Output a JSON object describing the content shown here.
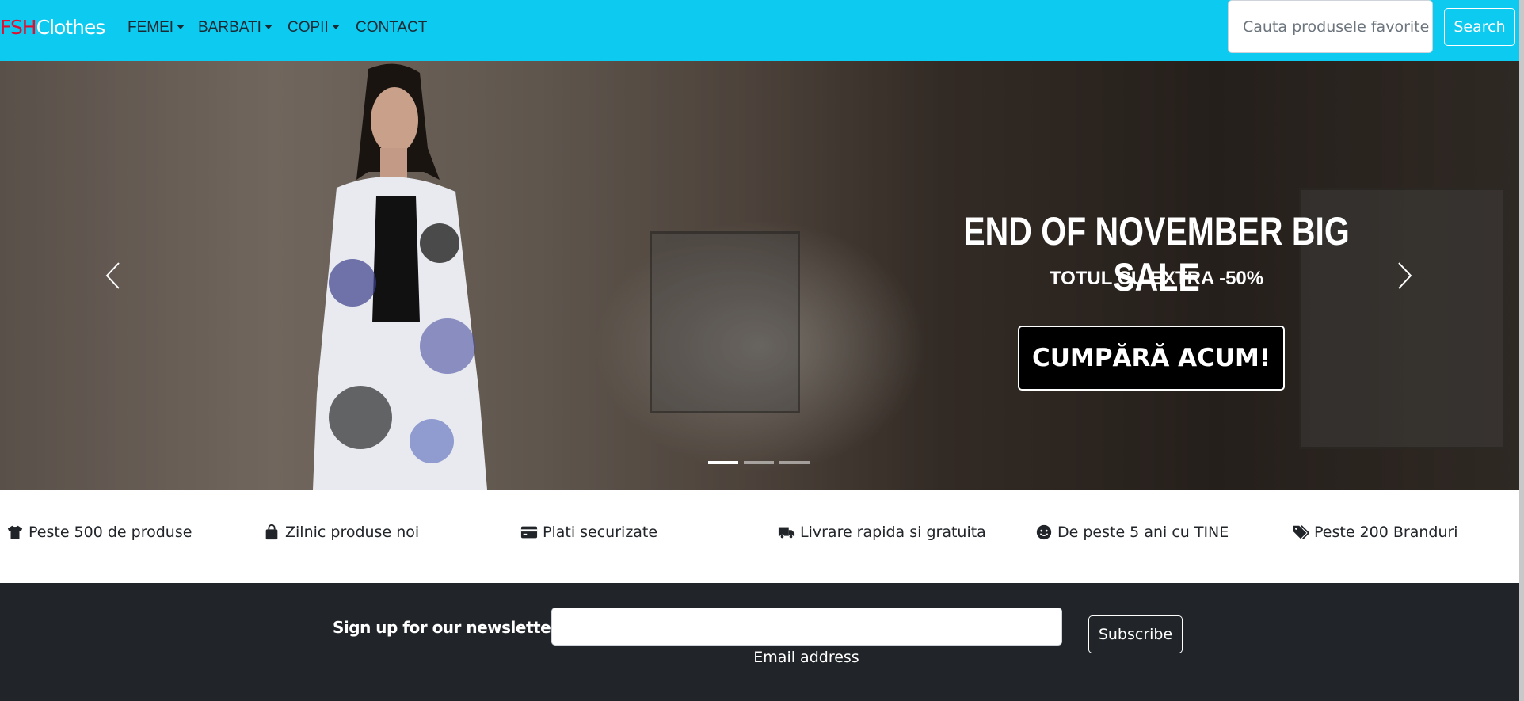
{
  "navbar": {
    "brand_red": "FSH",
    "brand_white": "Clothes",
    "items": [
      {
        "label": "FEMEI",
        "dropdown": true
      },
      {
        "label": "BARBATI",
        "dropdown": true
      },
      {
        "label": "COPII",
        "dropdown": true
      },
      {
        "label": "CONTACT",
        "dropdown": false
      }
    ],
    "search_placeholder": "Cauta produsele favorite",
    "search_button": "Search",
    "color": "#0dcaf0"
  },
  "carousel": {
    "title": "END OF NOVEMBER BIG SALE",
    "subtitle": "TOTUL CU EXTRA -50%",
    "cta": "CUMPĂRĂ ACUM!",
    "active_slide": 1,
    "slide_count": 3
  },
  "features": [
    {
      "icon": "tshirt-icon",
      "label": "Peste 500 de produse"
    },
    {
      "icon": "shopping-bag-icon",
      "label": "Zilnic produse noi"
    },
    {
      "icon": "credit-card-icon",
      "label": "Plati securizate"
    },
    {
      "icon": "truck-icon",
      "label": "Livrare rapida si gratuita"
    },
    {
      "icon": "smile-icon",
      "label": "De peste 5 ani cu TINE"
    },
    {
      "icon": "tags-icon",
      "label": "Peste 200 Branduri"
    }
  ],
  "newsletter": {
    "heading": "Sign up for our newsletter",
    "email_value": "",
    "email_label": "Email address",
    "subscribe": "Subscribe"
  }
}
